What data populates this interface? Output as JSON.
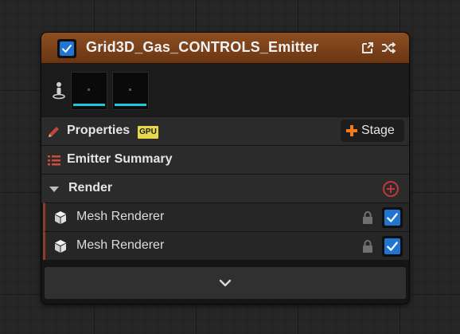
{
  "node": {
    "title": "Grid3D_Gas_CONTROLS_Emitter",
    "enabled": true,
    "header_color": "#7a4017",
    "header_icons": [
      "open-external-icon",
      "shuffle-icon"
    ]
  },
  "thumbnails": {
    "icon": "person-pin-icon",
    "items": [
      "thumbnail-1",
      "thumbnail-2"
    ]
  },
  "sections": {
    "properties": {
      "label": "Properties",
      "badge": "GPU",
      "icon": "pencil-icon"
    },
    "stage_button": {
      "label": "Stage",
      "icon": "plus-icon"
    },
    "emitter_summary": {
      "label": "Emitter Summary",
      "icon": "list-icon"
    },
    "render": {
      "label": "Render",
      "icon": "collapse-arrow-icon",
      "add_icon": "add-circle-icon"
    }
  },
  "renderers": [
    {
      "label": "Mesh Renderer",
      "enabled": true,
      "locked": true
    },
    {
      "label": "Mesh Renderer",
      "enabled": true,
      "locked": true
    }
  ],
  "expand": {
    "icon": "chevron-down-icon"
  },
  "colors": {
    "accent_blue": "#1f75d0",
    "stage_plus": "#f07a1c",
    "gpu_badge": "#e8d84a",
    "render_add": "#c0373b",
    "thumb_bar": "#1ec8dc"
  }
}
